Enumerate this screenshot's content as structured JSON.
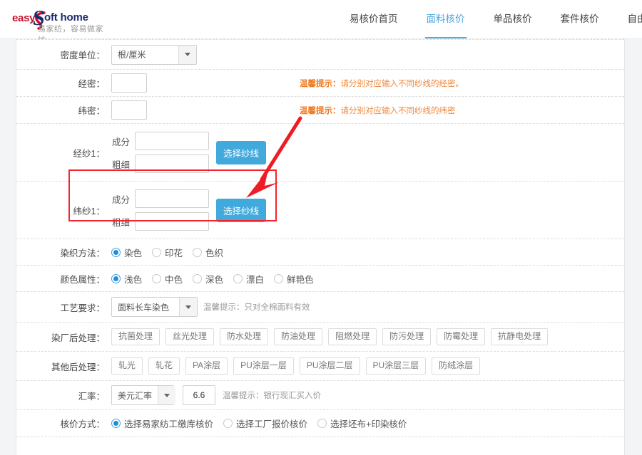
{
  "header": {
    "logo": {
      "easy": "easy",
      "s_mark": "S",
      "soft_home": "oft home",
      "tagline": "易家纺，容易做家纺"
    },
    "nav": [
      {
        "label": "易核价首页",
        "active": false
      },
      {
        "label": "面料核价",
        "active": true
      },
      {
        "label": "单品核价",
        "active": false
      },
      {
        "label": "套件核价",
        "active": false
      },
      {
        "label": "自由组合",
        "active": false
      }
    ]
  },
  "form": {
    "density_unit": {
      "label": "密度单位：",
      "value": "根/厘米"
    },
    "warp_density": {
      "label": "经密：",
      "value": "",
      "hint_prefix": "温馨提示：",
      "hint_text": "请分别对应输入不同纱线的经密。"
    },
    "weft_density": {
      "label": "纬密：",
      "value": "",
      "hint_prefix": "温馨提示：",
      "hint_text": "请分别对应输入不同纱线的纬密"
    },
    "warp_yarn": {
      "label": "经纱1：",
      "composition_label": "成分",
      "composition_value": "",
      "thickness_label": "粗细",
      "thickness_value": "",
      "button_label": "选择纱线"
    },
    "weft_yarn": {
      "label": "纬纱1：",
      "composition_label": "成分",
      "composition_value": "",
      "thickness_label": "粗细",
      "thickness_value": "",
      "button_label": "选择纱线"
    },
    "dye_method": {
      "label": "染织方法：",
      "options": [
        {
          "label": "染色",
          "selected": true
        },
        {
          "label": "印花",
          "selected": false
        },
        {
          "label": "色织",
          "selected": false
        }
      ]
    },
    "color_property": {
      "label": "颜色属性：",
      "options": [
        {
          "label": "浅色",
          "selected": true
        },
        {
          "label": "中色",
          "selected": false
        },
        {
          "label": "深色",
          "selected": false
        },
        {
          "label": "漂白",
          "selected": false
        },
        {
          "label": "鲜艳色",
          "selected": false
        }
      ]
    },
    "craft_requirement": {
      "label": "工艺要求：",
      "value": "面料长车染色",
      "hint": "温馨提示：只对全棉面料有效"
    },
    "dye_post_process": {
      "label": "染厂后处理：",
      "tags": [
        "抗菌处理",
        "丝光处理",
        "防水处理",
        "防油处理",
        "阻燃处理",
        "防污处理",
        "防霉处理",
        "抗静电处理"
      ]
    },
    "other_post_process": {
      "label": "其他后处理：",
      "tags": [
        "轧光",
        "轧花",
        "PA涂层",
        "PU涂层一层",
        "PU涂层二层",
        "PU涂层三层",
        "防绒涂层"
      ]
    },
    "exchange_rate": {
      "label": "汇率：",
      "currency": "美元汇率",
      "value": "6.6",
      "hint": "温馨提示：银行现汇买入价"
    },
    "pricing_method": {
      "label": "核价方式：",
      "options": [
        {
          "label": "选择易家纺工缴库核价",
          "selected": true
        },
        {
          "label": "选择工厂报价核价",
          "selected": false
        },
        {
          "label": "选择坯布+印染核价",
          "selected": false
        }
      ]
    }
  },
  "annotations": {
    "highlight_color": "#f5232b",
    "arrow_color": "#ee1c25",
    "accent_color": "#41a9dc",
    "hint_color": "#ef7b23"
  }
}
